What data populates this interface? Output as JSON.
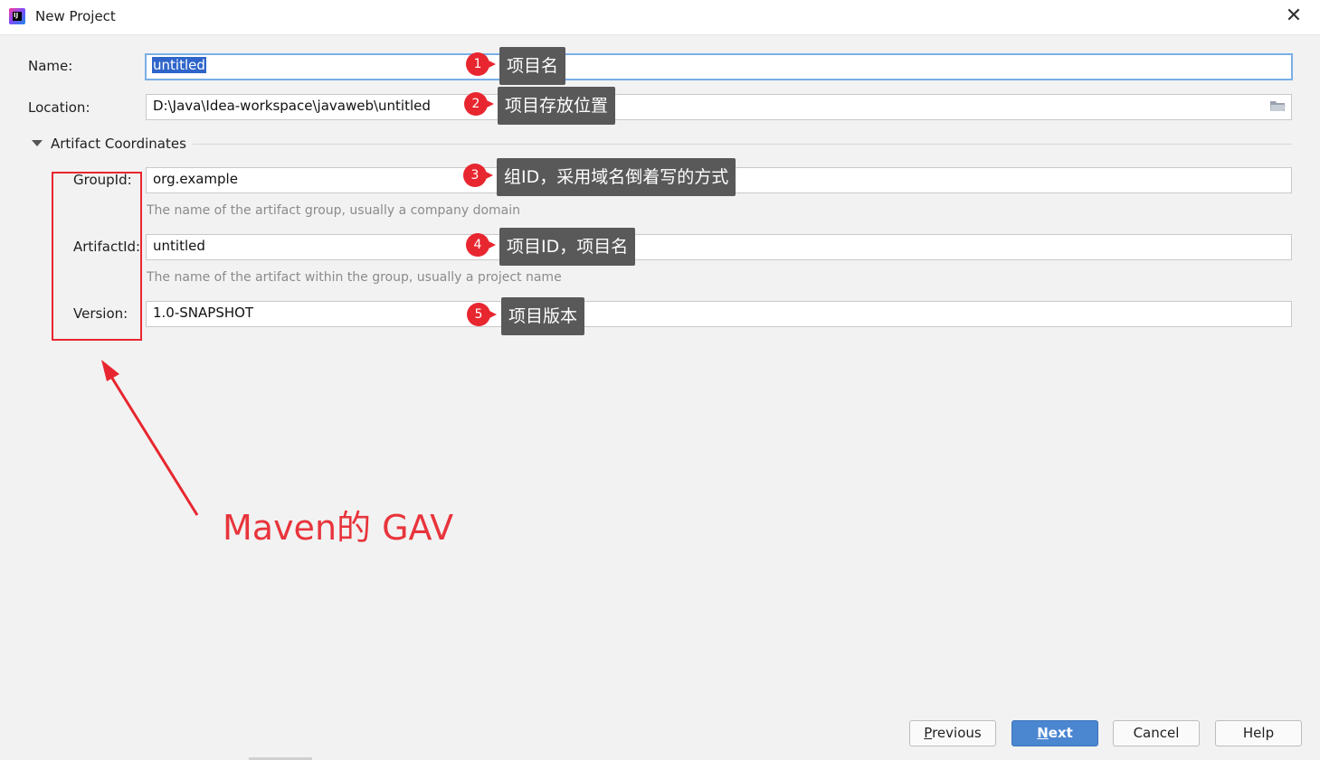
{
  "window": {
    "title": "New Project",
    "close_glyph": "✕",
    "app_icon_text": "IJ"
  },
  "form": {
    "name_label": "Name:",
    "name_value": "untitled",
    "location_label": "Location:",
    "location_value": "D:\\Java\\Idea-workspace\\javaweb\\untitled",
    "section_title": "Artifact Coordinates",
    "groupid_label": "GroupId:",
    "groupid_value": "org.example",
    "groupid_hint": "The name of the artifact group, usually a company domain",
    "artifactid_label": "ArtifactId:",
    "artifactid_value": "untitled",
    "artifactid_hint": "The name of the artifact within the group, usually a project name",
    "version_label": "Version:",
    "version_value": "1.0-SNAPSHOT"
  },
  "annotations": {
    "items": [
      {
        "number": "1",
        "text": "项目名"
      },
      {
        "number": "2",
        "text": "项目存放位置"
      },
      {
        "number": "3",
        "text": "组ID，采用域名倒着写的方式"
      },
      {
        "number": "4",
        "text": "项目ID，项目名"
      },
      {
        "number": "5",
        "text": "项目版本"
      }
    ],
    "gav_label": "Maven的 GAV",
    "color": "#e8262f"
  },
  "buttons": {
    "previous_first": "P",
    "previous_rest": "revious",
    "next_first": "N",
    "next_rest": "ext",
    "cancel": "Cancel",
    "help": "Help"
  },
  "colors": {
    "primary_button": "#4b86d1",
    "selection": "#2f65ca",
    "background": "#f2f2f2"
  }
}
